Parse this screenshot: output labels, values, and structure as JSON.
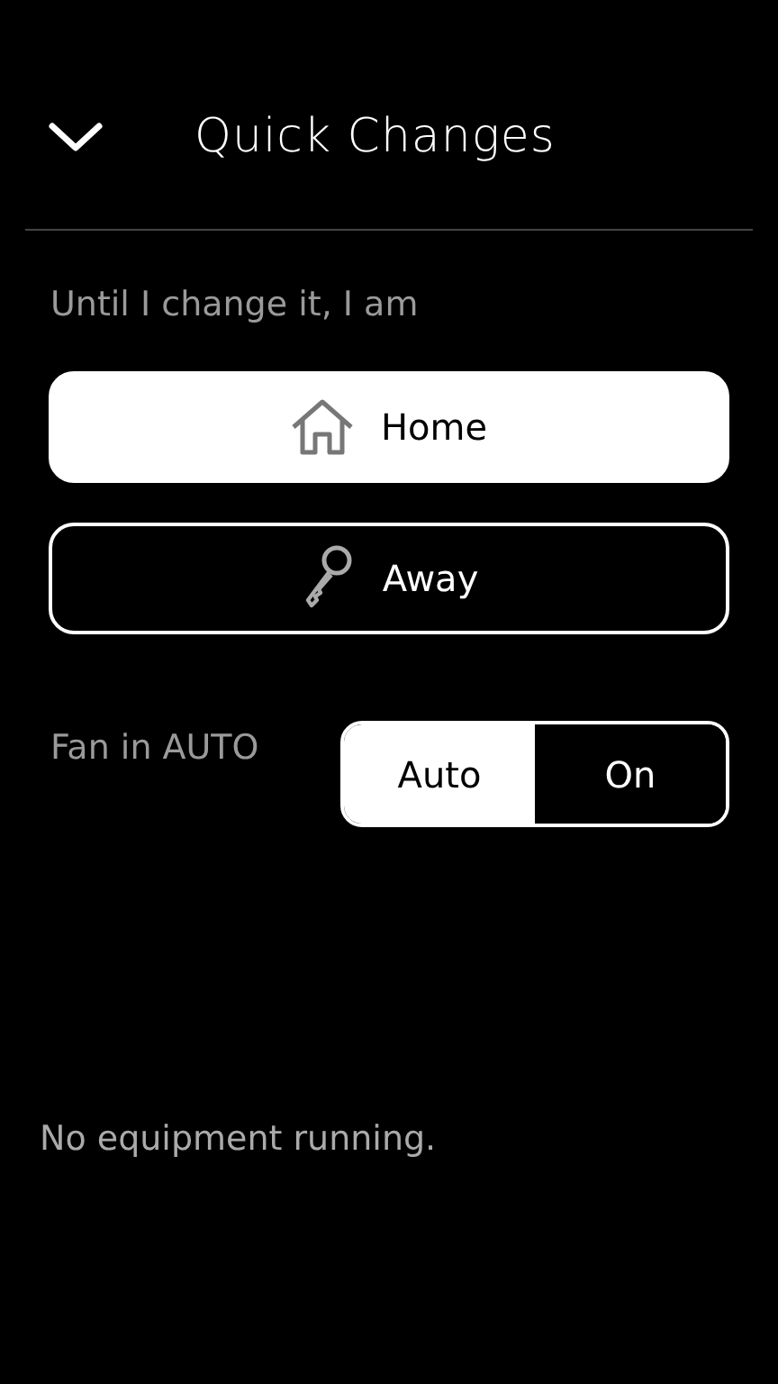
{
  "header": {
    "title": "Quick Changes"
  },
  "mode_prompt": "Until I change it, I am",
  "modes": [
    {
      "kind": "home",
      "label": "Home",
      "selected": true
    },
    {
      "kind": "away",
      "label": "Away",
      "selected": false
    }
  ],
  "fan": {
    "label": "Fan in AUTO",
    "options": [
      {
        "label": "Auto",
        "selected": true
      },
      {
        "label": "On",
        "selected": false
      }
    ]
  },
  "status": "No equipment running."
}
